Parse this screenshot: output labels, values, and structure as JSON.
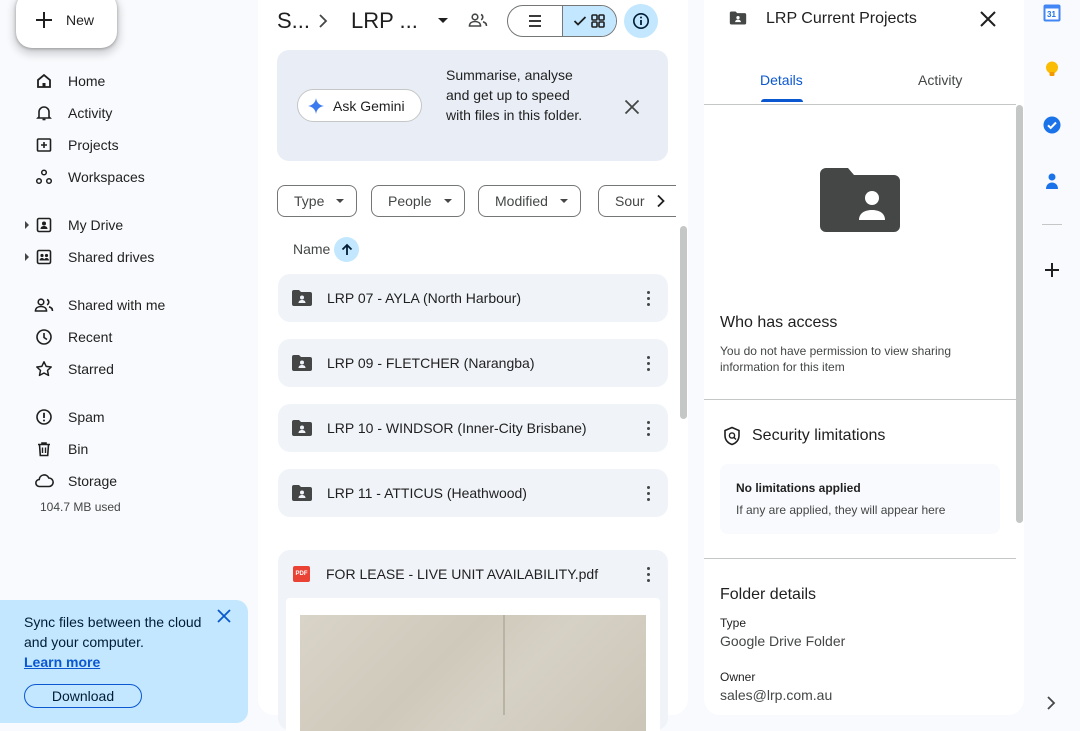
{
  "new_button": {
    "label": "New"
  },
  "sidebar": {
    "items": [
      {
        "label": "Home",
        "icon": "home-icon"
      },
      {
        "label": "Activity",
        "icon": "bell-icon"
      },
      {
        "label": "Projects",
        "icon": "projects-icon"
      },
      {
        "label": "Workspaces",
        "icon": "workspaces-icon"
      },
      {
        "label": "My Drive",
        "icon": "my-drive-icon"
      },
      {
        "label": "Shared drives",
        "icon": "shared-drives-icon"
      },
      {
        "label": "Shared with me",
        "icon": "people-icon"
      },
      {
        "label": "Recent",
        "icon": "clock-icon"
      },
      {
        "label": "Starred",
        "icon": "star-icon"
      },
      {
        "label": "Spam",
        "icon": "spam-icon"
      },
      {
        "label": "Bin",
        "icon": "bin-icon"
      },
      {
        "label": "Storage",
        "icon": "cloud-icon"
      }
    ],
    "storage_used": "104.7 MB used"
  },
  "sync_banner": {
    "text": "Sync files between the cloud and your computer.",
    "learn_more": "Learn more",
    "download": "Download"
  },
  "header": {
    "breadcrumb_parent": "S...",
    "breadcrumb_current": "LRP ..."
  },
  "gemini": {
    "button": "Ask Gemini",
    "text": "Summarise, analyse and get up to speed with files in this folder."
  },
  "filters": {
    "chips": [
      "Type",
      "People",
      "Modified",
      "Sour"
    ]
  },
  "list": {
    "sort_column": "Name",
    "folders": [
      "LRP 07 - AYLA (North Harbour)",
      "LRP 09 - FLETCHER (Narangba)",
      "LRP 10 - WINDSOR (Inner-City Brisbane)",
      "LRP 11 - ATTICUS (Heathwood)"
    ],
    "files": [
      {
        "name": "FOR LEASE - LIVE UNIT AVAILABILITY.pdf",
        "type_badge": "PDF"
      }
    ]
  },
  "details": {
    "title": "LRP Current Projects",
    "tabs": [
      "Details",
      "Activity"
    ],
    "active_tab": "Details",
    "access_heading": "Who has access",
    "access_text": "You do not have permission to view sharing information for this item",
    "security_heading": "Security limitations",
    "security_box_title": "No limitations applied",
    "security_box_text": "If any are applied, they will appear here",
    "folder_details_heading": "Folder details",
    "type_label": "Type",
    "type_value": "Google Drive Folder",
    "owner_label": "Owner",
    "owner_value": "sales@lrp.com.au"
  },
  "rail": {
    "calendar_day": "31"
  },
  "colors": {
    "accent": "#0b57d0",
    "selected_bg": "#c2e7ff",
    "page_bg": "#f8fafd",
    "card_bg": "#f0f4f9"
  }
}
